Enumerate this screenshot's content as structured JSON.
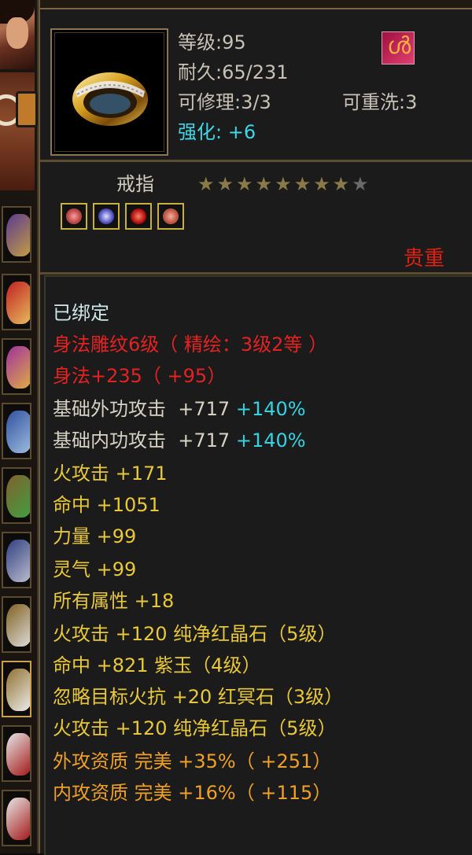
{
  "item": {
    "level_label": "等级:95",
    "durability_label": "耐久:65/231",
    "repair_label": "可修理:3/3",
    "rewash_label": "可重洗:3",
    "enhance_label": "强化:",
    "enhance_value": "+6",
    "type": "戒指",
    "stars": "★★★★★★★★",
    "stars_empty": "★",
    "rarity": "贵重"
  },
  "colors": {
    "bound": "#cfe6e8",
    "red": "#e52222",
    "white": "#d8d2c4",
    "cyan": "#32d4e4",
    "yellow": "#e8c83a",
    "orange": "#f0a028"
  },
  "gems": [
    "rose-gem-icon",
    "blue-gem-icon",
    "ruby-gem-icon",
    "rose-gem-icon"
  ],
  "details": {
    "bound": "已绑定",
    "engrave": "身法雕纹6级（ 精绘：3级2等 ）",
    "agility": "身法+235（ +95）",
    "ext_atk_label": "基础外功攻击",
    "ext_atk_value": "+717",
    "ext_atk_pct": "+140%",
    "int_atk_label": "基础内功攻击",
    "int_atk_value": "+717",
    "int_atk_pct": "+140%",
    "fire_atk": "火攻击  +171",
    "hit": "命中  +1051",
    "str": "力量  +99",
    "spirit": "灵气  +99",
    "all_attr": "所有属性  +18",
    "gem1": "火攻击  +120  纯净红晶石（5级）",
    "gem2": "命中  +821  紫玉（4级）",
    "gem3": "忽略目标火抗  +20  红冥石（3级）",
    "gem4": "火攻击  +120  纯净红晶石（5级）",
    "ext_quality": "外攻资质    完美  +35%（ +251）",
    "int_quality": "内攻资质    完美  +16%（ +115）"
  }
}
